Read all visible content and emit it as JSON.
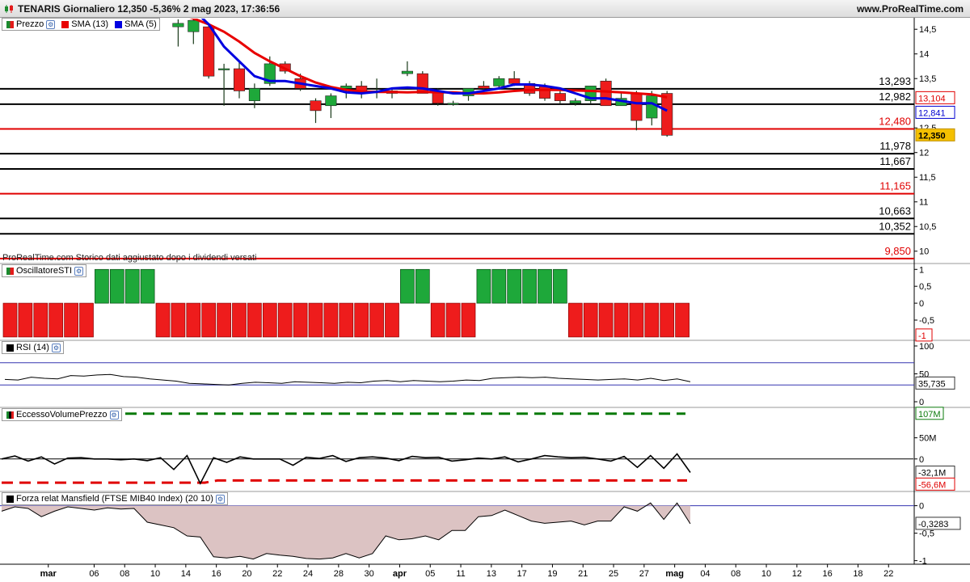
{
  "title": "TENARIS Giornaliero 12,350 -5,36% 2 mag 2023, 17:36:56",
  "website": "www.ProRealTime.com",
  "note": "ProRealTime.com Storico dati aggiustato dopo i dividendi versati",
  "legends": {
    "price": {
      "items": [
        {
          "label": "Prezzo",
          "color": "#1b8a2e",
          "color2": "#e21b1b"
        },
        {
          "label": "SMA (13)",
          "color": "#e80000"
        },
        {
          "label": "SMA (5)",
          "color": "#0000e0"
        }
      ]
    },
    "sti": {
      "label": "OscillatoreSTI"
    },
    "rsi": {
      "label": "RSI (14)"
    },
    "evp": {
      "label": "EccessoVolumePrezzo"
    },
    "mansfield": {
      "label": "Forza relat Mansfield (FTSE MIB40 Index) (20 10)"
    }
  },
  "x_axis": {
    "ticks": [
      {
        "i": -1,
        "label": "24"
      },
      {
        "i": 2.5,
        "label": "mar",
        "bold": true
      },
      {
        "i": 5.5,
        "label": "06"
      },
      {
        "i": 7.5,
        "label": "08"
      },
      {
        "i": 9.5,
        "label": "10"
      },
      {
        "i": 11.5,
        "label": "14"
      },
      {
        "i": 13.5,
        "label": "16"
      },
      {
        "i": 15.5,
        "label": "20"
      },
      {
        "i": 17.5,
        "label": "22"
      },
      {
        "i": 19.5,
        "label": "24"
      },
      {
        "i": 21.5,
        "label": "28"
      },
      {
        "i": 23.5,
        "label": "30"
      },
      {
        "i": 25.5,
        "label": "apr",
        "bold": true
      },
      {
        "i": 27.5,
        "label": "05"
      },
      {
        "i": 29.5,
        "label": "11"
      },
      {
        "i": 31.5,
        "label": "13"
      },
      {
        "i": 33.5,
        "label": "17"
      },
      {
        "i": 35.5,
        "label": "19"
      },
      {
        "i": 37.5,
        "label": "21"
      },
      {
        "i": 39.5,
        "label": "25"
      },
      {
        "i": 41.5,
        "label": "27"
      },
      {
        "i": 43.5,
        "label": "mag",
        "bold": true
      },
      {
        "i": 45.5,
        "label": "04"
      },
      {
        "i": 47.5,
        "label": "08"
      },
      {
        "i": 49.5,
        "label": "10"
      },
      {
        "i": 51.5,
        "label": "12"
      },
      {
        "i": 53.5,
        "label": "16"
      },
      {
        "i": 55.5,
        "label": "18"
      },
      {
        "i": 57.5,
        "label": "22"
      }
    ]
  },
  "chart_data": [
    {
      "type": "candlestick",
      "title": "TENARIS Giornaliero",
      "ylim": [
        9.75,
        14.7
      ],
      "y_ticks": [
        "14,5",
        "14",
        "13,5",
        "12,5",
        "12",
        "11,5",
        "11",
        "10,5",
        "10"
      ],
      "candles": [
        {
          "o": 14.55,
          "h": 14.7,
          "l": 14.15,
          "c": 14.62
        },
        {
          "o": 14.45,
          "h": 14.7,
          "l": 14.2,
          "c": 14.68
        },
        {
          "o": 14.55,
          "h": 14.6,
          "l": 13.5,
          "c": 13.55
        },
        {
          "o": 13.7,
          "h": 13.8,
          "l": 12.95,
          "c": 13.7
        },
        {
          "o": 13.7,
          "h": 13.85,
          "l": 13.1,
          "c": 13.25
        },
        {
          "o": 13.05,
          "h": 13.4,
          "l": 12.9,
          "c": 13.3
        },
        {
          "o": 13.4,
          "h": 13.95,
          "l": 13.35,
          "c": 13.8
        },
        {
          "o": 13.8,
          "h": 13.85,
          "l": 13.6,
          "c": 13.65
        },
        {
          "o": 13.5,
          "h": 13.6,
          "l": 13.25,
          "c": 13.3
        },
        {
          "o": 13.05,
          "h": 13.1,
          "l": 12.6,
          "c": 12.85
        },
        {
          "o": 12.95,
          "h": 13.2,
          "l": 12.7,
          "c": 13.15
        },
        {
          "o": 13.3,
          "h": 13.4,
          "l": 13.1,
          "c": 13.35
        },
        {
          "o": 13.35,
          "h": 13.45,
          "l": 13.1,
          "c": 13.25
        },
        {
          "o": 13.25,
          "h": 13.5,
          "l": 13.1,
          "c": 13.25
        },
        {
          "o": 13.25,
          "h": 13.3,
          "l": 13.1,
          "c": 13.2
        },
        {
          "o": 13.6,
          "h": 13.85,
          "l": 13.55,
          "c": 13.65
        },
        {
          "o": 13.6,
          "h": 13.65,
          "l": 13.2,
          "c": 13.2
        },
        {
          "o": 13.25,
          "h": 13.3,
          "l": 12.95,
          "c": 13.0
        },
        {
          "o": 13.0,
          "h": 13.05,
          "l": 12.95,
          "c": 13.0
        },
        {
          "o": 13.15,
          "h": 13.3,
          "l": 13.05,
          "c": 13.3
        },
        {
          "o": 13.35,
          "h": 13.45,
          "l": 13.25,
          "c": 13.3
        },
        {
          "o": 13.35,
          "h": 13.55,
          "l": 13.3,
          "c": 13.5
        },
        {
          "o": 13.5,
          "h": 13.65,
          "l": 13.35,
          "c": 13.4
        },
        {
          "o": 13.4,
          "h": 13.45,
          "l": 13.15,
          "c": 13.2
        },
        {
          "o": 13.35,
          "h": 13.4,
          "l": 13.05,
          "c": 13.1
        },
        {
          "o": 13.2,
          "h": 13.25,
          "l": 13.0,
          "c": 13.05
        },
        {
          "o": 13.0,
          "h": 13.1,
          "l": 12.95,
          "c": 13.05
        },
        {
          "o": 13.05,
          "h": 13.35,
          "l": 13.0,
          "c": 13.35
        },
        {
          "o": 13.45,
          "h": 13.5,
          "l": 12.95,
          "c": 12.95
        },
        {
          "o": 12.95,
          "h": 13.2,
          "l": 12.95,
          "c": 13.1
        },
        {
          "o": 13.2,
          "h": 13.25,
          "l": 12.45,
          "c": 12.65
        },
        {
          "o": 12.7,
          "h": 13.25,
          "l": 12.55,
          "c": 13.15
        },
        {
          "o": 13.2,
          "h": 13.25,
          "l": 12.32,
          "c": 12.35
        }
      ],
      "sma13": [
        14.8,
        14.72,
        14.6,
        14.45,
        14.25,
        14.02,
        13.85,
        13.7,
        13.55,
        13.42,
        13.33,
        13.27,
        13.24,
        13.23,
        13.23,
        13.22,
        13.23,
        13.22,
        13.22,
        13.2,
        13.2,
        13.22,
        13.25,
        13.27,
        13.27,
        13.27,
        13.26,
        13.25,
        13.24,
        13.22,
        13.2,
        13.18,
        13.12
      ],
      "sma5": [
        15.0,
        14.9,
        14.6,
        14.15,
        13.85,
        13.55,
        13.45,
        13.45,
        13.4,
        13.35,
        13.3,
        13.22,
        13.2,
        13.23,
        13.3,
        13.32,
        13.3,
        13.25,
        13.2,
        13.2,
        13.25,
        13.3,
        13.38,
        13.38,
        13.35,
        13.3,
        13.2,
        13.1,
        13.1,
        13.05,
        13.0,
        13.0,
        12.85
      ],
      "levels": [
        {
          "value": 13.293,
          "label": "13,293",
          "color": "#000000"
        },
        {
          "value": 12.982,
          "label": "12,982",
          "color": "#000000"
        },
        {
          "value": 12.48,
          "label": "12,480",
          "color": "#e00000"
        },
        {
          "value": 11.978,
          "label": "11,978",
          "color": "#000000"
        },
        {
          "value": 11.667,
          "label": "11,667",
          "color": "#000000"
        },
        {
          "value": 11.165,
          "label": "11,165",
          "color": "#e00000"
        },
        {
          "value": 10.663,
          "label": "10,663",
          "color": "#000000"
        },
        {
          "value": 10.352,
          "label": "10,352",
          "color": "#000000"
        },
        {
          "value": 9.85,
          "label": "9,850",
          "color": "#e00000"
        }
      ],
      "badges": [
        {
          "label": "13,104",
          "kind": "sma13"
        },
        {
          "label": "12,841",
          "kind": "sma5"
        },
        {
          "label": "12,350",
          "kind": "last"
        }
      ]
    },
    {
      "type": "bar",
      "title": "OscillatoreSTI",
      "ylim": [
        -1.05,
        1.15
      ],
      "y_ticks": [
        "1",
        "0,5",
        "0",
        "-0,5"
      ],
      "values": [
        -1,
        -1,
        -1,
        -1,
        -1,
        -1,
        1,
        1,
        1,
        1,
        -1,
        -1,
        -1,
        -1,
        -1,
        -1,
        -1,
        -1,
        -1,
        -1,
        -1,
        -1,
        -1,
        -1,
        -1,
        -1,
        1,
        1,
        -1,
        -1,
        -1,
        1,
        1,
        1,
        1,
        1,
        1,
        -1,
        -1,
        -1,
        -1,
        -1,
        -1,
        -1,
        -1
      ],
      "badge": "-1"
    },
    {
      "type": "line",
      "title": "RSI (14)",
      "ylim": [
        0,
        100
      ],
      "y_ticks": [
        "100",
        "50",
        "0"
      ],
      "bands": [
        70,
        30
      ],
      "values": [
        40,
        39,
        44,
        42,
        41,
        47,
        46,
        48,
        49,
        45,
        44,
        41,
        39,
        37,
        33,
        32,
        31,
        30,
        33,
        35,
        34,
        33,
        36,
        35,
        34,
        33,
        35,
        34,
        37,
        38,
        36,
        38,
        37,
        36,
        37,
        39,
        38,
        42,
        43,
        44,
        43,
        44,
        42,
        41,
        40,
        39,
        40,
        41,
        39,
        42,
        38,
        41,
        36
      ],
      "badge": "35,735"
    },
    {
      "type": "line",
      "title": "EccessoVolumePrezzo",
      "ylim": [
        -75,
        120
      ],
      "y_ticks": [
        "50M",
        "0"
      ],
      "upper": 107,
      "lower_values": [
        -56,
        -56,
        -56,
        -56,
        -56,
        -56,
        -56,
        -56,
        -56,
        -56,
        -56,
        -56,
        -56,
        -56,
        -56,
        -56,
        -56,
        -51,
        -51,
        -51,
        -51,
        -51,
        -51,
        -51,
        -51,
        -51,
        -51,
        -51,
        -51,
        -51,
        -51,
        -51,
        -51,
        -51,
        -51,
        -51,
        -51,
        -51,
        -51,
        -51,
        -51,
        -51,
        -51,
        -51,
        -51,
        -51,
        -51,
        -51,
        -51,
        -51,
        -51,
        -51,
        -51,
        -51,
        -51
      ],
      "values": [
        0,
        7,
        -5,
        5,
        -12,
        2,
        3,
        0,
        0,
        -2,
        0,
        -4,
        3,
        -25,
        8,
        -58,
        3,
        -8,
        5,
        0,
        0,
        0,
        -15,
        4,
        1,
        8,
        -6,
        3,
        5,
        2,
        -4,
        6,
        3,
        4,
        -5,
        -2,
        2,
        0,
        5,
        -7,
        0,
        8,
        5,
        3,
        4,
        0,
        -5,
        6,
        -20,
        8,
        -22,
        12,
        -32
      ],
      "badges": [
        "107M",
        "-32,1M",
        "-56,6M"
      ]
    },
    {
      "type": "area",
      "title": "Forza relat Mansfield (FTSE MIB40 Index) (20 10)",
      "ylim": [
        -1.05,
        0.2
      ],
      "y_ticks": [
        "0",
        "-0,5",
        "-1"
      ],
      "values": [
        -0.1,
        -0.02,
        -0.05,
        -0.2,
        -0.1,
        -0.02,
        -0.05,
        -0.08,
        -0.04,
        -0.06,
        -0.05,
        -0.3,
        -0.35,
        -0.4,
        -0.55,
        -0.57,
        -0.93,
        -0.95,
        -0.92,
        -0.97,
        -0.87,
        -0.9,
        -0.92,
        -0.96,
        -0.97,
        -0.95,
        -0.87,
        -0.95,
        -0.87,
        -0.55,
        -0.62,
        -0.6,
        -0.55,
        -0.62,
        -0.45,
        -0.45,
        -0.2,
        -0.18,
        -0.08,
        -0.18,
        -0.28,
        -0.32,
        -0.3,
        -0.28,
        -0.35,
        -0.28,
        -0.28,
        -0.02,
        -0.1,
        0.05,
        -0.25,
        0.05,
        -0.33
      ],
      "badge": "-0,3283"
    }
  ]
}
